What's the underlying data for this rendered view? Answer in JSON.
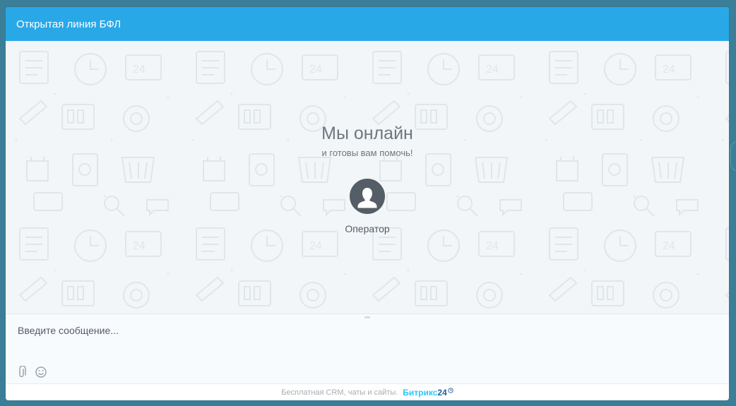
{
  "window": {
    "title": "Открытая линия БФЛ"
  },
  "welcome": {
    "title": "Мы онлайн",
    "subtitle": "и готовы вам помочь!"
  },
  "operator": {
    "name": "Оператор",
    "avatar_icon": "user-silhouette-icon"
  },
  "composer": {
    "placeholder": "Введите сообщение...",
    "value": "",
    "attach_icon": "paperclip-icon",
    "emoji_icon": "smiley-icon"
  },
  "footer": {
    "text": "Бесплатная CRM, чаты и сайты.",
    "brand": "Битрикс",
    "brand_suffix": "24",
    "brand_icon": "clock-icon"
  },
  "colors": {
    "header": "#29a8e8",
    "page_bg": "#3a7f97",
    "chat_bg": "#f2f6f8",
    "brand_light": "#2fc6f6",
    "brand_dark": "#215f98"
  }
}
